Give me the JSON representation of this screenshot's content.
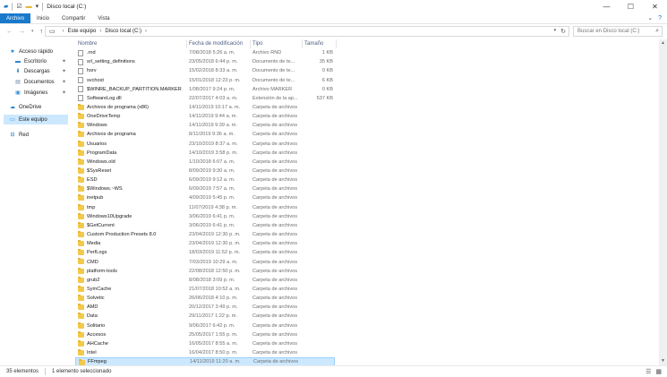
{
  "window": {
    "title": "Disco local (C:)",
    "controls": [
      "—",
      "☐",
      "✕"
    ]
  },
  "ribbon": {
    "tabs": [
      {
        "label": "Archivo",
        "active": true
      },
      {
        "label": "Inicio",
        "active": false
      },
      {
        "label": "Compartir",
        "active": false
      },
      {
        "label": "Vista",
        "active": false
      }
    ]
  },
  "address": {
    "crumbs": [
      "Este equipo",
      "Disco local (C:)"
    ]
  },
  "search": {
    "placeholder": "Buscar en Disco local (C:)"
  },
  "navpane": {
    "items": [
      {
        "label": "Acceso rápido",
        "icon": "star-icon",
        "pinned": false,
        "selected": false
      },
      {
        "label": "Escritorio",
        "icon": "desktop-icon",
        "pinned": true,
        "selected": false
      },
      {
        "label": "Descargas",
        "icon": "download-icon",
        "pinned": true,
        "selected": false
      },
      {
        "label": "Documentos",
        "icon": "documents-icon",
        "pinned": true,
        "selected": false
      },
      {
        "label": "Imágenes",
        "icon": "pictures-icon",
        "pinned": true,
        "selected": false
      },
      {
        "label": "OneDrive",
        "icon": "cloud-icon",
        "pinned": false,
        "selected": false
      },
      {
        "label": "Este equipo",
        "icon": "computer-icon",
        "pinned": false,
        "selected": true
      },
      {
        "label": "Red",
        "icon": "network-icon",
        "pinned": false,
        "selected": false
      }
    ]
  },
  "columns": {
    "name": "Nombre",
    "date": "Fecha de modificación",
    "type": "Tipo",
    "size": "Tamaño"
  },
  "files": [
    {
      "name": ".rnd",
      "date": "7/08/2018 5:26 a. m.",
      "type": "Archivo RND",
      "size": "1 KB",
      "kind": "file"
    },
    {
      "name": "srl_setting_definitions",
      "date": "23/05/2018 6:44 p. m.",
      "type": "Documento de te...",
      "size": "35 KB",
      "kind": "file"
    },
    {
      "name": "hsrv",
      "date": "15/02/2018 8:33 a. m.",
      "type": "Documento de te...",
      "size": "0 KB",
      "kind": "file"
    },
    {
      "name": "svchost",
      "date": "15/01/2018 12:23 p. m.",
      "type": "Documento de te...",
      "size": "6 KB",
      "kind": "file"
    },
    {
      "name": "$WINRE_BACKUP_PARTITION.MARKER",
      "date": "1/08/2017 9:24 p. m.",
      "type": "Archivo MARKER",
      "size": "0 KB",
      "kind": "file"
    },
    {
      "name": "SoftwareLog.dll",
      "date": "22/07/2017 4:03 a. m.",
      "type": "Extensión de la ap...",
      "size": "537 KB",
      "kind": "file"
    },
    {
      "name": "Archivos de programa (x86)",
      "date": "14/11/2019 10:17 a. m.",
      "type": "Carpeta de archivos",
      "size": "",
      "kind": "folder"
    },
    {
      "name": "OneDriveTemp",
      "date": "14/11/2019 9:44 a. m.",
      "type": "Carpeta de archivos",
      "size": "",
      "kind": "folder"
    },
    {
      "name": "Windows",
      "date": "14/11/2019 9:39 a. m.",
      "type": "Carpeta de archivos",
      "size": "",
      "kind": "folder"
    },
    {
      "name": "Archivos de programa",
      "date": "8/11/2019 9:36 a. m.",
      "type": "Carpeta de archivos",
      "size": "",
      "kind": "folder"
    },
    {
      "name": "Usuarios",
      "date": "23/10/2019 8:37 a. m.",
      "type": "Carpeta de archivos",
      "size": "",
      "kind": "folder"
    },
    {
      "name": "ProgramData",
      "date": "14/10/2019 3:58 p. m.",
      "type": "Carpeta de archivos",
      "size": "",
      "kind": "folder"
    },
    {
      "name": "Windows.old",
      "date": "1/10/2018 6:07 a. m.",
      "type": "Carpeta de archivos",
      "size": "",
      "kind": "folder"
    },
    {
      "name": "$SysReset",
      "date": "8/09/2019 9:30 a. m.",
      "type": "Carpeta de archivos",
      "size": "",
      "kind": "folder"
    },
    {
      "name": "ESD",
      "date": "6/09/2019 9:12 a. m.",
      "type": "Carpeta de archivos",
      "size": "",
      "kind": "folder"
    },
    {
      "name": "$Windows.~WS",
      "date": "6/09/2019 7:57 a. m.",
      "type": "Carpeta de archivos",
      "size": "",
      "kind": "folder"
    },
    {
      "name": "inetpub",
      "date": "4/09/2019 5:45 p. m.",
      "type": "Carpeta de archivos",
      "size": "",
      "kind": "folder"
    },
    {
      "name": "tmp",
      "date": "11/07/2019 4:38 p. m.",
      "type": "Carpeta de archivos",
      "size": "",
      "kind": "folder"
    },
    {
      "name": "Windows10Upgrade",
      "date": "3/06/2019 6:41 p. m.",
      "type": "Carpeta de archivos",
      "size": "",
      "kind": "folder"
    },
    {
      "name": "$GetCurrent",
      "date": "3/06/2019 6:41 p. m.",
      "type": "Carpeta de archivos",
      "size": "",
      "kind": "folder"
    },
    {
      "name": "Custom Production Presets 8.0",
      "date": "23/04/2019 12:30 p. m.",
      "type": "Carpeta de archivos",
      "size": "",
      "kind": "folder"
    },
    {
      "name": "Media",
      "date": "23/04/2019 12:30 p. m.",
      "type": "Carpeta de archivos",
      "size": "",
      "kind": "folder"
    },
    {
      "name": "PerfLogs",
      "date": "18/03/2019 11:52 p. m.",
      "type": "Carpeta de archivos",
      "size": "",
      "kind": "folder"
    },
    {
      "name": "CMD",
      "date": "7/03/2019 10:29 a. m.",
      "type": "Carpeta de archivos",
      "size": "",
      "kind": "folder"
    },
    {
      "name": "platform-tools",
      "date": "22/08/2018 12:50 p. m.",
      "type": "Carpeta de archivos",
      "size": "",
      "kind": "folder"
    },
    {
      "name": "grub2",
      "date": "8/08/2018 3:09 p. m.",
      "type": "Carpeta de archivos",
      "size": "",
      "kind": "folder"
    },
    {
      "name": "SymCache",
      "date": "21/07/2018 10:52 a. m.",
      "type": "Carpeta de archivos",
      "size": "",
      "kind": "folder"
    },
    {
      "name": "Solvetic",
      "date": "26/06/2018 4:10 p. m.",
      "type": "Carpeta de archivos",
      "size": "",
      "kind": "folder"
    },
    {
      "name": "AMD",
      "date": "20/12/2017 3:49 p. m.",
      "type": "Carpeta de archivos",
      "size": "",
      "kind": "folder"
    },
    {
      "name": "Data",
      "date": "29/11/2017 1:22 p. m.",
      "type": "Carpeta de archivos",
      "size": "",
      "kind": "folder"
    },
    {
      "name": "Solitario",
      "date": "9/06/2017 6:42 p. m.",
      "type": "Carpeta de archivos",
      "size": "",
      "kind": "folder"
    },
    {
      "name": "Accesos",
      "date": "25/05/2017 1:55 p. m.",
      "type": "Carpeta de archivos",
      "size": "",
      "kind": "folder"
    },
    {
      "name": "AHCache",
      "date": "16/05/2017 8:55 a. m.",
      "type": "Carpeta de archivos",
      "size": "",
      "kind": "folder"
    },
    {
      "name": "Intel",
      "date": "16/04/2017 8:50 p. m.",
      "type": "Carpeta de archivos",
      "size": "",
      "kind": "folder"
    },
    {
      "name": "FFmpeg",
      "date": "14/11/2019 11:20 a. m.",
      "type": "Carpeta de archivos",
      "size": "",
      "kind": "folder",
      "selected": true
    }
  ],
  "statusbar": {
    "count": "35 elementos",
    "selection": "1 elemento seleccionado"
  },
  "colors": {
    "accent": "#1979ca",
    "selection": "#cce8ff",
    "folder": "#f2c94c"
  }
}
